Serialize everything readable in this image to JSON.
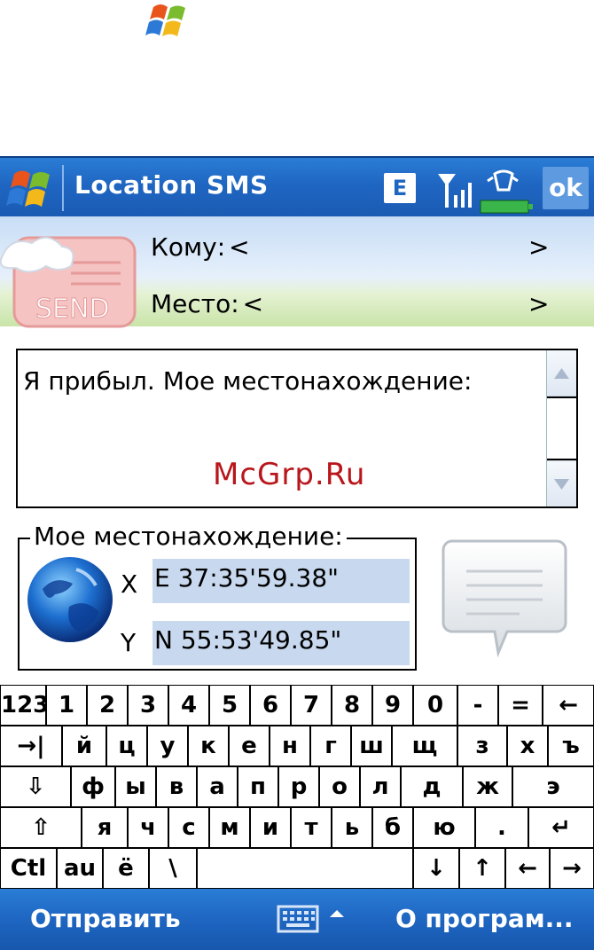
{
  "app": {
    "title": "Location SMS",
    "ok_label": "ok",
    "network_badge": "E"
  },
  "header": {
    "to_label": "Кому:",
    "to_value_open": "<",
    "to_value_close": ">",
    "place_label": "Место:",
    "place_value_open": "<",
    "place_value_close": ">"
  },
  "message": {
    "text": "Я прибыл. Мое местонахождение:"
  },
  "watermark": "McGrp.Ru",
  "location": {
    "legend": "Мое местонахождение:",
    "x_label": "X",
    "x_value": "E 37:35'59.38\"",
    "y_label": "Y",
    "y_value": "N 55:53'49.85\""
  },
  "keyboard": {
    "row1": [
      "123",
      "1",
      "2",
      "3",
      "4",
      "5",
      "6",
      "7",
      "8",
      "9",
      "0",
      "-",
      "=",
      "←"
    ],
    "row2": [
      "→|",
      "й",
      "ц",
      "у",
      "к",
      "е",
      "н",
      "г",
      "ш",
      "щ",
      "з",
      "х",
      "ъ"
    ],
    "row3": [
      "⇩",
      "ф",
      "ы",
      "в",
      "а",
      "п",
      "р",
      "о",
      "л",
      "д",
      "ж",
      "э"
    ],
    "row4": [
      "⇧",
      "я",
      "ч",
      "с",
      "м",
      "и",
      "т",
      "ь",
      "б",
      "ю",
      ".",
      "↵"
    ],
    "row5": [
      "Ctl",
      "au",
      "ё",
      "\\",
      "",
      "↓",
      "↑",
      "←",
      "→"
    ]
  },
  "menu": {
    "left": "Отправить",
    "right": "О програм..."
  },
  "colors": {
    "titlebar": "#1f66c2",
    "coord_highlight": "#c8d9ef",
    "watermark": "#b8161b"
  }
}
